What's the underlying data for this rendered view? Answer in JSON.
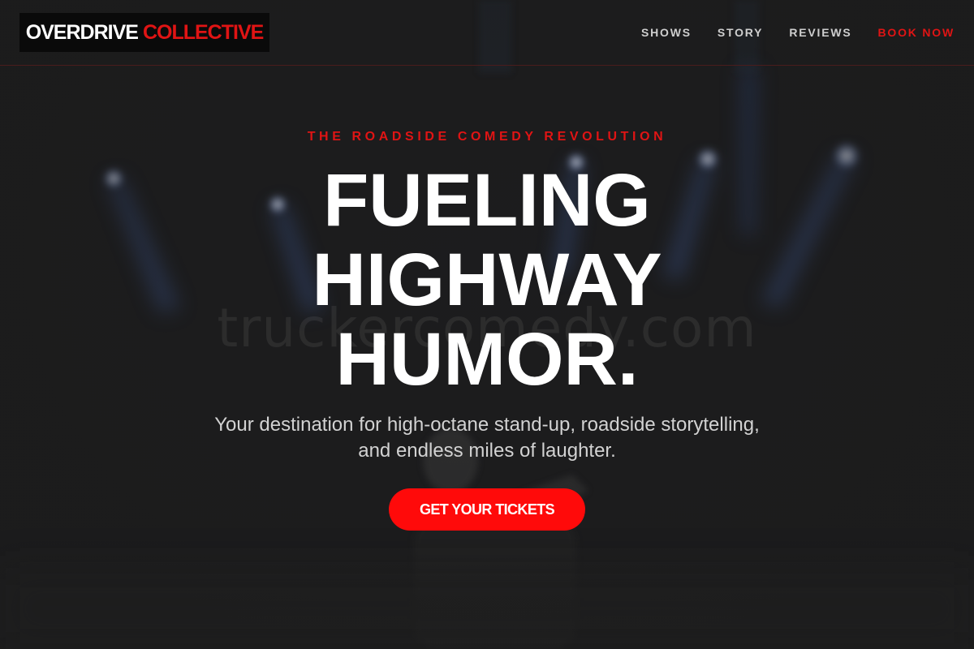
{
  "brand": {
    "name_primary": "OVERDRIVE",
    "name_accent": "COLLECTIVE"
  },
  "nav": {
    "items": [
      {
        "label": "SHOWS"
      },
      {
        "label": "STORY"
      },
      {
        "label": "REVIEWS"
      },
      {
        "label": "BOOK NOW"
      }
    ]
  },
  "hero": {
    "eyebrow": "THE ROADSIDE COMEDY REVOLUTION",
    "headline": [
      "FUELING",
      "HIGHWAY",
      "HUMOR."
    ],
    "subtitle": [
      "Your destination for high-octane stand-up, roadside storytelling,",
      "and endless miles of laughter."
    ],
    "cta_label": "GET YOUR TICKETS",
    "background_image": "stage-spotlights-performer",
    "watermark": "truckercomedy.com"
  },
  "colors": {
    "accent": "#e01414",
    "cta": "#ff0a0a",
    "background": "#1b1b1b",
    "text": "#ffffff",
    "muted_text": "#d2d2d2",
    "spotlight": "#6e8fd6"
  }
}
